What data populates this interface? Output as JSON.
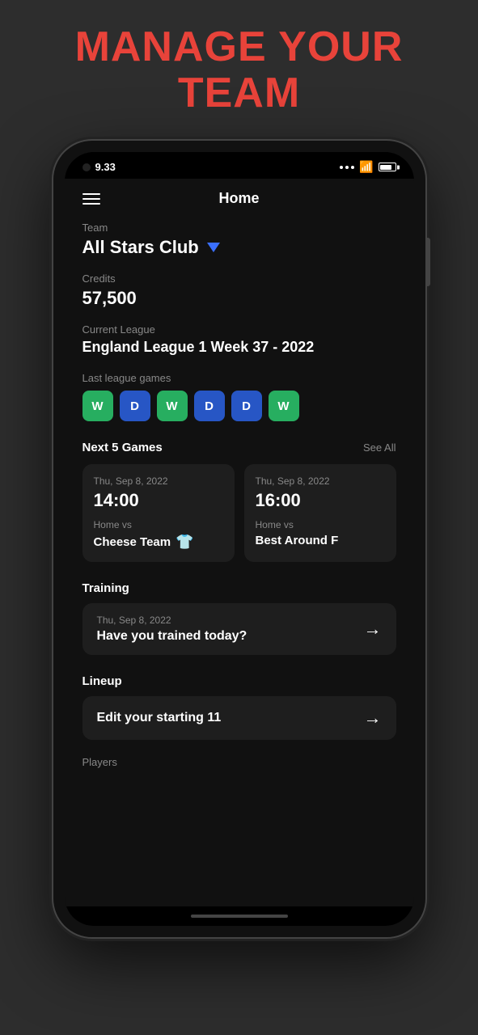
{
  "header": {
    "title": "MANAGE YOUR\nTEAM"
  },
  "statusBar": {
    "time": "9.33",
    "camera": true
  },
  "nav": {
    "title": "Home"
  },
  "team": {
    "label": "Team",
    "name": "All Stars Club"
  },
  "credits": {
    "label": "Credits",
    "value": "57,500"
  },
  "league": {
    "label": "Current League",
    "name": "England League 1 Week 37 - 2022"
  },
  "lastGames": {
    "label": "Last league games",
    "badges": [
      {
        "type": "W",
        "cssClass": "badge-w"
      },
      {
        "type": "D",
        "cssClass": "badge-d"
      },
      {
        "type": "W",
        "cssClass": "badge-w"
      },
      {
        "type": "D",
        "cssClass": "badge-d"
      },
      {
        "type": "D",
        "cssClass": "badge-d"
      },
      {
        "type": "W",
        "cssClass": "badge-w"
      }
    ]
  },
  "nextGames": {
    "title": "Next 5 Games",
    "seeAll": "See All",
    "games": [
      {
        "date": "Thu, Sep 8, 2022",
        "time": "14:00",
        "vsLabel": "Home vs",
        "opponent": "Cheese Team",
        "hasJersey": true
      },
      {
        "date": "Thu, Sep 8, 2022",
        "time": "16:00",
        "vsLabel": "Home vs",
        "opponent": "Best Around F",
        "hasJersey": false
      }
    ]
  },
  "training": {
    "sectionLabel": "Training",
    "card": {
      "date": "Thu, Sep 8, 2022",
      "label": "Have you trained today?",
      "arrow": "→"
    }
  },
  "lineup": {
    "sectionLabel": "Lineup",
    "card": {
      "label": "Edit your starting 11",
      "arrow": "→"
    }
  },
  "players": {
    "label": "Players"
  }
}
